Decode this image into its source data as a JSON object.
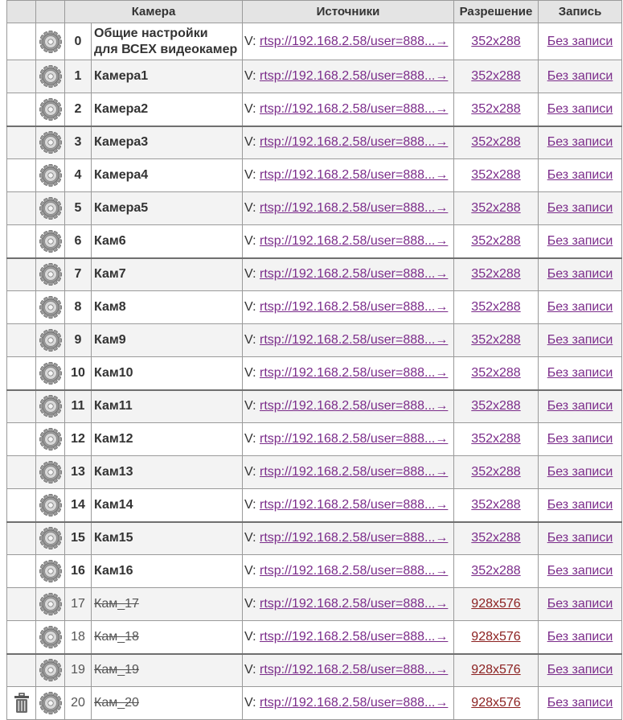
{
  "headers": {
    "camera": "Камера",
    "sources": "Источники",
    "resolution": "Разрешение",
    "recording": "Запись"
  },
  "source_prefix": "V:",
  "colors": {
    "header_bg": "#e4e4e4",
    "link": "#7b2c8a",
    "link_disabled": "#8b1f1f",
    "row_alt": "#f3f3f3"
  },
  "icons": {
    "settings": "gear-icon",
    "delete": "trash-icon"
  },
  "rows": [
    {
      "num": "0",
      "name": [
        "Общие настройки",
        "для ВСЕХ видеокамер"
      ],
      "source": "rtsp://192.168.2.58/user=888...→",
      "resolution": "352x288",
      "recording": "Без записи",
      "enabled": true,
      "group_start": false,
      "delete_icon": false
    },
    {
      "num": "1",
      "name": [
        "Камера1"
      ],
      "source": "rtsp://192.168.2.58/user=888...→",
      "resolution": "352x288",
      "recording": "Без записи",
      "enabled": true,
      "group_start": false,
      "delete_icon": false
    },
    {
      "num": "2",
      "name": [
        "Камера2"
      ],
      "source": "rtsp://192.168.2.58/user=888...→",
      "resolution": "352x288",
      "recording": "Без записи",
      "enabled": true,
      "group_start": false,
      "delete_icon": false
    },
    {
      "num": "3",
      "name": [
        "Камера3"
      ],
      "source": "rtsp://192.168.2.58/user=888...→",
      "resolution": "352x288",
      "recording": "Без записи",
      "enabled": true,
      "group_start": true,
      "delete_icon": false
    },
    {
      "num": "4",
      "name": [
        "Камера4"
      ],
      "source": "rtsp://192.168.2.58/user=888...→",
      "resolution": "352x288",
      "recording": "Без записи",
      "enabled": true,
      "group_start": false,
      "delete_icon": false
    },
    {
      "num": "5",
      "name": [
        "Камера5"
      ],
      "source": "rtsp://192.168.2.58/user=888...→",
      "resolution": "352x288",
      "recording": "Без записи",
      "enabled": true,
      "group_start": false,
      "delete_icon": false
    },
    {
      "num": "6",
      "name": [
        "Кам6"
      ],
      "source": "rtsp://192.168.2.58/user=888...→",
      "resolution": "352x288",
      "recording": "Без записи",
      "enabled": true,
      "group_start": false,
      "delete_icon": false
    },
    {
      "num": "7",
      "name": [
        "Кам7"
      ],
      "source": "rtsp://192.168.2.58/user=888...→",
      "resolution": "352x288",
      "recording": "Без записи",
      "enabled": true,
      "group_start": true,
      "delete_icon": false
    },
    {
      "num": "8",
      "name": [
        "Кам8"
      ],
      "source": "rtsp://192.168.2.58/user=888...→",
      "resolution": "352x288",
      "recording": "Без записи",
      "enabled": true,
      "group_start": false,
      "delete_icon": false
    },
    {
      "num": "9",
      "name": [
        "Кам9"
      ],
      "source": "rtsp://192.168.2.58/user=888...→",
      "resolution": "352x288",
      "recording": "Без записи",
      "enabled": true,
      "group_start": false,
      "delete_icon": false
    },
    {
      "num": "10",
      "name": [
        "Кам10"
      ],
      "source": "rtsp://192.168.2.58/user=888...→",
      "resolution": "352x288",
      "recording": "Без записи",
      "enabled": true,
      "group_start": false,
      "delete_icon": false
    },
    {
      "num": "11",
      "name": [
        "Кам11"
      ],
      "source": "rtsp://192.168.2.58/user=888...→",
      "resolution": "352x288",
      "recording": "Без записи",
      "enabled": true,
      "group_start": true,
      "delete_icon": false
    },
    {
      "num": "12",
      "name": [
        "Кам12"
      ],
      "source": "rtsp://192.168.2.58/user=888...→",
      "resolution": "352x288",
      "recording": "Без записи",
      "enabled": true,
      "group_start": false,
      "delete_icon": false
    },
    {
      "num": "13",
      "name": [
        "Кам13"
      ],
      "source": "rtsp://192.168.2.58/user=888...→",
      "resolution": "352x288",
      "recording": "Без записи",
      "enabled": true,
      "group_start": false,
      "delete_icon": false
    },
    {
      "num": "14",
      "name": [
        "Кам14"
      ],
      "source": "rtsp://192.168.2.58/user=888...→",
      "resolution": "352x288",
      "recording": "Без записи",
      "enabled": true,
      "group_start": false,
      "delete_icon": false
    },
    {
      "num": "15",
      "name": [
        "Кам15"
      ],
      "source": "rtsp://192.168.2.58/user=888...→",
      "resolution": "352x288",
      "recording": "Без записи",
      "enabled": true,
      "group_start": true,
      "delete_icon": false
    },
    {
      "num": "16",
      "name": [
        "Кам16"
      ],
      "source": "rtsp://192.168.2.58/user=888...→",
      "resolution": "352x288",
      "recording": "Без записи",
      "enabled": true,
      "group_start": false,
      "delete_icon": false
    },
    {
      "num": "17",
      "name": [
        "Кам_17"
      ],
      "source": "rtsp://192.168.2.58/user=888...→",
      "resolution": "928x576",
      "recording": "Без записи",
      "enabled": false,
      "group_start": false,
      "delete_icon": false
    },
    {
      "num": "18",
      "name": [
        "Кам_18"
      ],
      "source": "rtsp://192.168.2.58/user=888...→",
      "resolution": "928x576",
      "recording": "Без записи",
      "enabled": false,
      "group_start": false,
      "delete_icon": false
    },
    {
      "num": "19",
      "name": [
        "Кам_19"
      ],
      "source": "rtsp://192.168.2.58/user=888...→",
      "resolution": "928x576",
      "recording": "Без записи",
      "enabled": false,
      "group_start": true,
      "delete_icon": false
    },
    {
      "num": "20",
      "name": [
        "Кам_20"
      ],
      "source": "rtsp://192.168.2.58/user=888...→",
      "resolution": "928x576",
      "recording": "Без записи",
      "enabled": false,
      "group_start": false,
      "delete_icon": true
    }
  ]
}
